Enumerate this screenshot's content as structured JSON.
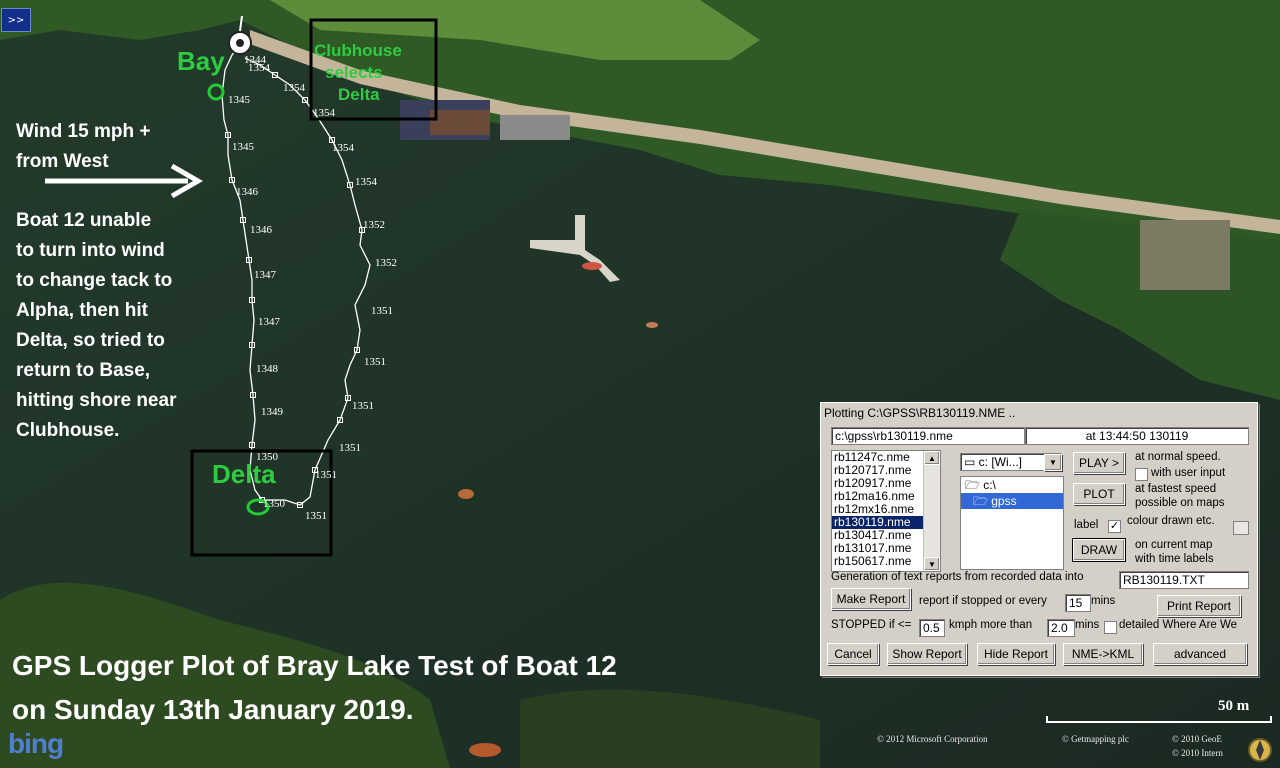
{
  "nav_button": ">>",
  "map": {
    "compass_label": "N",
    "base_label": "Bay",
    "clubhouse_label_lines": [
      "Clubhouse",
      "selects",
      "Delta"
    ],
    "delta_label": "Delta",
    "track_times_left": [
      "1344",
      "1345",
      "1345",
      "1346",
      "1346",
      "1347",
      "1347",
      "1348",
      "1349",
      "1350",
      "1350"
    ],
    "track_times_right": [
      "1354",
      "1354",
      "1354",
      "1354",
      "1354",
      "1352",
      "1352",
      "1351",
      "1351",
      "1351",
      "1351",
      "1351",
      "1351"
    ]
  },
  "wind_lines": [
    "Wind 15 mph +",
    "from West"
  ],
  "story_lines": [
    "Boat 12 unable",
    "to turn into wind",
    "to change tack to",
    "Alpha, then hit",
    "Delta, so tried to",
    "return to Base,",
    "hitting shore near",
    "Clubhouse."
  ],
  "caption_lines": [
    "GPS Logger Plot of Bray Lake Test of Boat 12",
    "on Sunday 13th January 2019."
  ],
  "scale_label": "50 m",
  "bing_logo": "bing",
  "copyrights": [
    "© 2012 Microsoft Corporation",
    "© Getmapping plc",
    "© 2010 GeoE",
    "© 2010 Intern"
  ],
  "dialog": {
    "title": "Plotting C:\\GPSS\\RB130119.NME ..",
    "file_path": "c:\\gpss\\rb130119.nme",
    "timestamp": "at 13:44:50 130119",
    "files": [
      "rb11247c.nme",
      "rb120717.nme",
      "rb120917.nme",
      "rb12ma16.nme",
      "rb12mx16.nme",
      "rb130119.nme",
      "rb130417.nme",
      "rb131017.nme",
      "rb150617.nme"
    ],
    "selected_file": "rb130119.nme",
    "drive_select": "c: [Wi...]",
    "dirs": [
      "c:\\",
      "gpss"
    ],
    "selected_dir": "gpss",
    "play_label": "PLAY >",
    "play_desc": "at normal speed.",
    "user_input_label": "with user input",
    "plot_label": "PLOT",
    "plot_desc_1": "at fastest speed",
    "plot_desc_2": "possible on maps",
    "label_text": "label",
    "label_checked": "✓",
    "colour_label": "colour drawn etc.",
    "draw_label": "DRAW",
    "draw_desc_1": "on current map",
    "draw_desc_2": "with time labels",
    "gen_text": "Generation of text reports from recorded data into",
    "report_file": "RB130119.TXT",
    "make_report_label": "Make Report",
    "report_if_text": "report if stopped or every",
    "report_every": "15",
    "mins_text": "mins",
    "print_report_label": "Print Report",
    "stopped_text": "STOPPED if <=",
    "stopped_speed": "0.5",
    "kmph_text": "kmph more than",
    "stopped_mins": "2.0",
    "mins2_text": "mins",
    "detailed_text": "detailed Where Are We",
    "cancel_label": "Cancel",
    "show_report_label": "Show Report",
    "hide_report_label": "Hide Report",
    "nme_kml_label": "NME->KML",
    "advanced_label": "advanced"
  }
}
